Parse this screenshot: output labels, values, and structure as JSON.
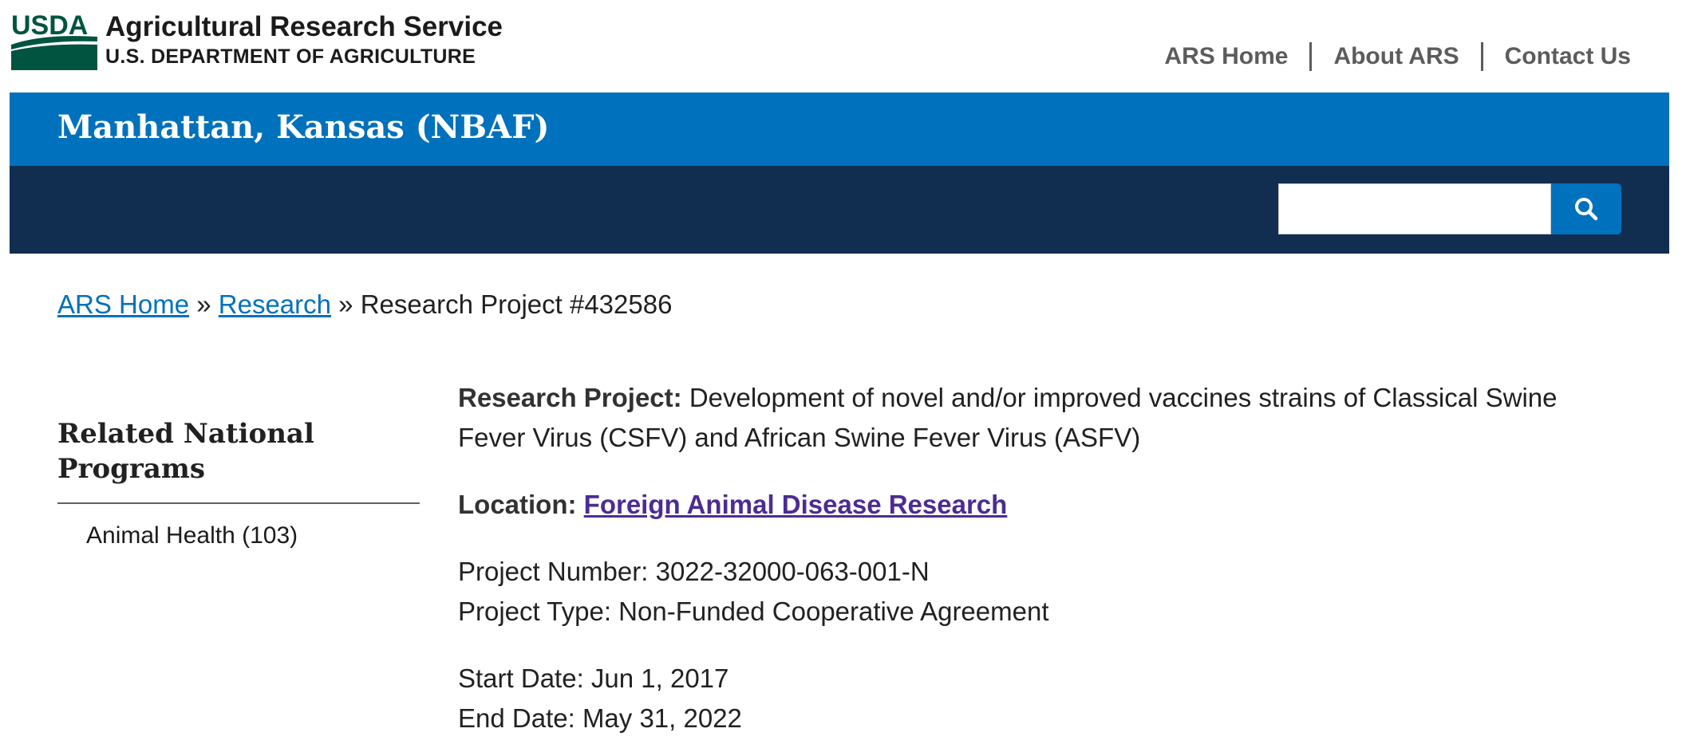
{
  "header": {
    "logo_text": "USDA",
    "site_name": "Agricultural Research Service",
    "department": "U.S. DEPARTMENT OF AGRICULTURE",
    "nav": [
      "ARS Home",
      "About ARS",
      "Contact Us"
    ]
  },
  "title_bar": {
    "title": "Manhattan, Kansas (NBAF)"
  },
  "search": {
    "value": "",
    "icon": "search-icon"
  },
  "breadcrumb": {
    "link1": "ARS Home",
    "sep": "»",
    "link2": "Research",
    "current": "Research Project #432586"
  },
  "sidebar": {
    "heading": "Related National Programs",
    "items": [
      "Animal Health (103)"
    ]
  },
  "main": {
    "project_label": "Research Project:",
    "project_title": "Development of novel and/or improved vaccines strains of Classical Swine Fever Virus (CSFV) and African Swine Fever Virus (ASFV)",
    "location_label": "Location:",
    "location_link": "Foreign Animal Disease Research",
    "project_number_label": "Project Number:",
    "project_number": "3022-32000-063-001-N",
    "project_type_label": "Project Type:",
    "project_type": "Non-Funded Cooperative Agreement",
    "start_date_label": "Start Date:",
    "start_date": "Jun 1, 2017",
    "end_date_label": "End Date:",
    "end_date": "May 31, 2022"
  },
  "colors": {
    "primary_blue": "#0071bc",
    "dark_navy": "#112e51",
    "visited_link": "#4c2c92",
    "usda_green": "#005440"
  }
}
